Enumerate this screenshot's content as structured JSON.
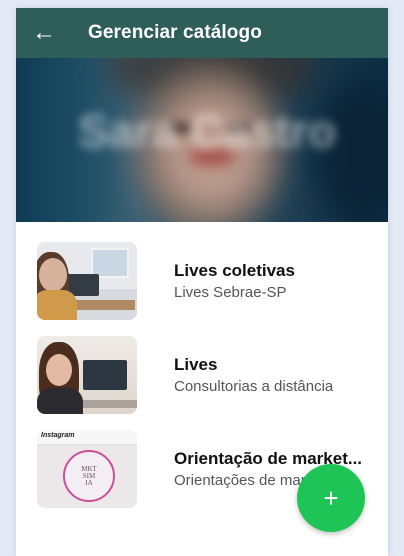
{
  "header": {
    "back_icon": "arrow-left-icon",
    "title": "Gerenciar catálogo",
    "color": "#2f5d5a"
  },
  "banner": {
    "blurred_text": "Sara Castro"
  },
  "catalog": {
    "items": [
      {
        "title": "Lives coletivas",
        "subtitle": "Lives Sebrae-SP"
      },
      {
        "title": "Lives",
        "subtitle": "Consultorias a distância"
      },
      {
        "title": "Orientação de market...",
        "subtitle": "Orientações de marketing",
        "thumb_label": "Instagram",
        "thumb_logo": [
          "MKT",
          "SIM",
          "IA"
        ]
      }
    ]
  },
  "fab": {
    "label": "+",
    "icon": "plus-icon",
    "color": "#1fc457"
  }
}
